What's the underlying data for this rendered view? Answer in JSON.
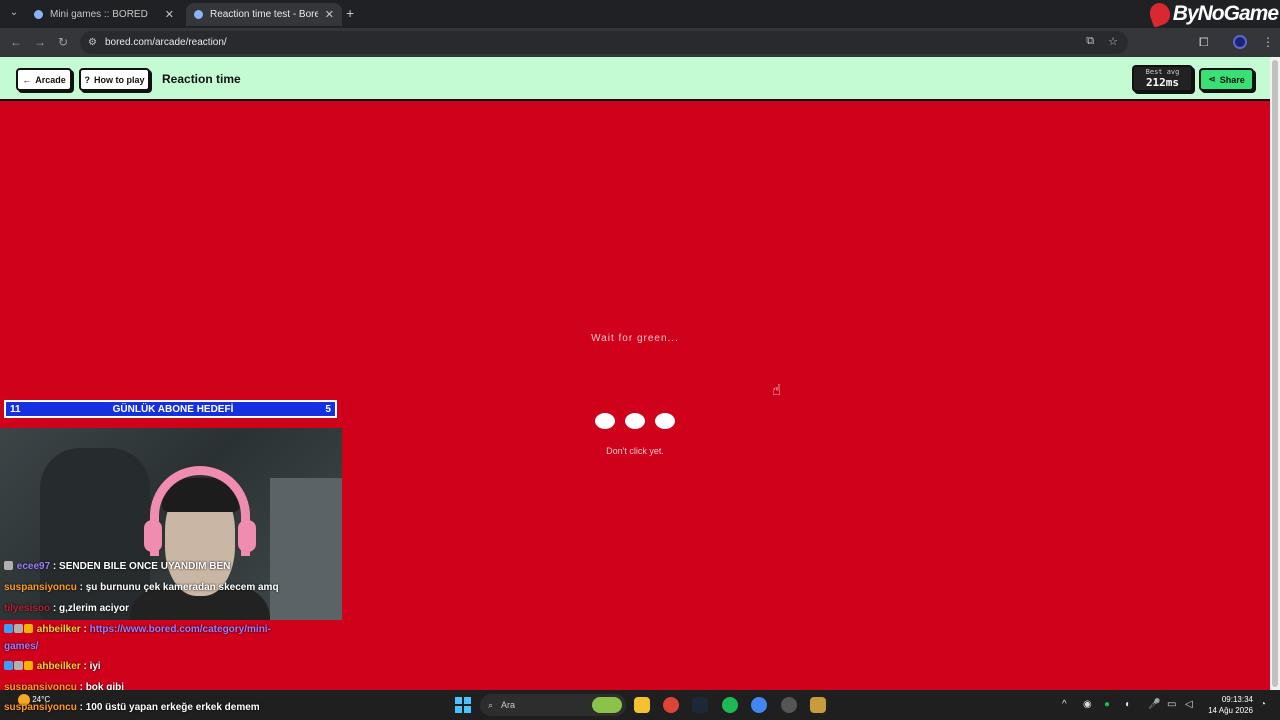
{
  "browser": {
    "tabs": [
      {
        "title": "Mini games :: BORED",
        "active": false
      },
      {
        "title": "Reaction time test - Bored.com",
        "active": true
      }
    ],
    "url": "bored.com/arcade/reaction/",
    "brand": "ByNoGame"
  },
  "game": {
    "arcade_label": "Arcade",
    "howto_label": "How to play",
    "title": "Reaction time",
    "best_label": "Best avg",
    "best_value": "212ms",
    "share_label": "Share",
    "wait_text": "Wait for green...",
    "hint_text": "Don't click yet."
  },
  "colors": {
    "game_bg": "#d0021b",
    "header_bg": "#c4fbd3",
    "share_bg": "#39e075"
  },
  "stream": {
    "goal": {
      "left": "11",
      "label": "GÜNLÜK ABONE HEDEFİ",
      "right": "5"
    },
    "chat": [
      {
        "badges": [
          "gray"
        ],
        "user": "ecee97",
        "color": "purple",
        "text": "SENDEN BILE ONCE UYANDIM BEN"
      },
      {
        "badges": [],
        "user": "suspansiyoncu",
        "color": "orange",
        "text": "şu burnunu çek kameradan skecem amq"
      },
      {
        "badges": [],
        "user": "tilyesisoo",
        "color": "red",
        "text": "g,zlerim aciyor"
      },
      {
        "badges": [
          "blue",
          "gray",
          "gold"
        ],
        "user": "ahbeilker",
        "color": "gold",
        "text": "https://www.bored.com/category/mini-",
        "text2": "games/"
      },
      {
        "badges": [
          "blue",
          "gray",
          "gold"
        ],
        "user": "ahbeilker",
        "color": "gold",
        "text": "iyi"
      },
      {
        "badges": [],
        "user": "suspansiyoncu",
        "color": "orange",
        "text": "bok gibi"
      },
      {
        "badges": [],
        "user": "suspansiyoncu",
        "color": "orange",
        "text": "100 üstü yapan erkeğe erkek demem"
      }
    ]
  },
  "taskbar": {
    "temperature": "24°C",
    "search_placeholder": "Ara",
    "time": "09:13:34",
    "date": "14 Ağu 2026"
  }
}
